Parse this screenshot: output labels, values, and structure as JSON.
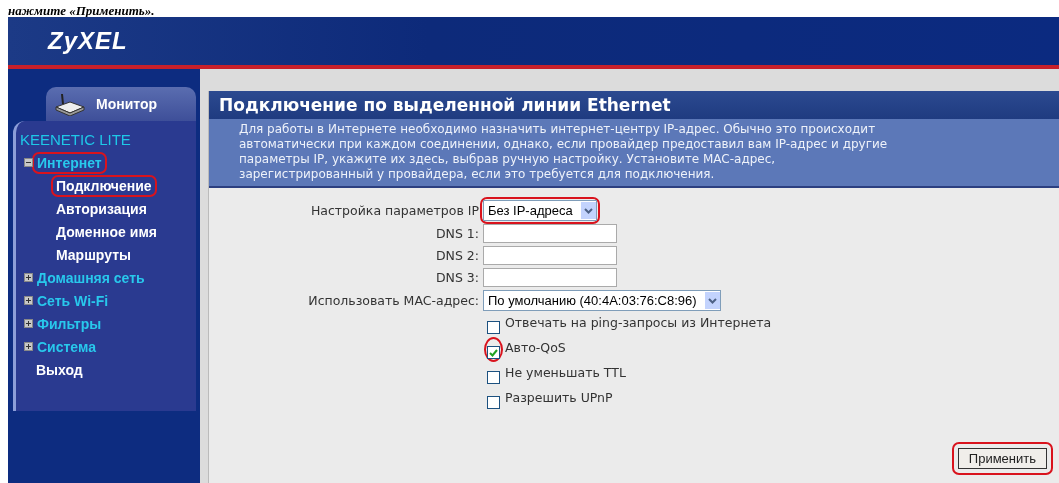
{
  "caption": "нажмите «Применить».",
  "brand": "ZyXEL",
  "sidebar": {
    "monitor_tab": "Монитор",
    "device": "KEENETIC LITE",
    "items": [
      {
        "kind": "group",
        "label": "Интернет",
        "expanded": true,
        "highlighted": true,
        "children": [
          {
            "label": "Подключение",
            "highlighted": true
          },
          {
            "label": "Авторизация",
            "highlighted": false
          },
          {
            "label": "Доменное имя",
            "highlighted": false
          },
          {
            "label": "Маршруты",
            "highlighted": false
          }
        ]
      },
      {
        "kind": "group",
        "label": "Домашняя сеть",
        "expanded": false,
        "highlighted": false
      },
      {
        "kind": "group",
        "label": "Сеть Wi-Fi",
        "expanded": false,
        "highlighted": false
      },
      {
        "kind": "group",
        "label": "Фильтры",
        "expanded": false,
        "highlighted": false
      },
      {
        "kind": "group",
        "label": "Система",
        "expanded": false,
        "highlighted": false
      },
      {
        "kind": "link",
        "label": "Выход",
        "highlighted": false
      }
    ]
  },
  "page": {
    "title": "Подключение по выделенной линии Ethernet",
    "description": "Для работы в Интернете необходимо назначить интернет-центру IP-адрес. Обычно это происходит автоматически при каждом соединении, однако, если провайдер предоставил вам IP-адрес и другие параметры IP, укажите их здесь, выбрав ручную настройку. Установите MAC-адрес, зарегистрированный у провайдера, если это требуется для подключения.",
    "fields": [
      {
        "kind": "select",
        "label": "Настройка параметров IP",
        "value": "Без IP-адреса",
        "highlighted": true
      },
      {
        "kind": "text",
        "label": "DNS 1:",
        "highlighted": false
      },
      {
        "kind": "text",
        "label": "DNS 2:",
        "highlighted": false
      },
      {
        "kind": "text",
        "label": "DNS 3:",
        "highlighted": false
      },
      {
        "kind": "select",
        "label": "Использовать MAC-адрес:",
        "value": "По умолчанию (40:4A:03:76:C8:96)",
        "highlighted": false
      }
    ],
    "checkboxes": [
      {
        "label": "Отвечать на ping-запросы из Интернета",
        "checked": false,
        "highlighted": false
      },
      {
        "label": "Авто-QoS",
        "checked": true,
        "highlighted": true
      },
      {
        "label": "Не уменьшать TTL",
        "checked": false,
        "highlighted": false
      },
      {
        "label": "Разрешить UPnP",
        "checked": false,
        "highlighted": false
      }
    ],
    "apply_button": {
      "label": "Применить",
      "highlighted": true
    }
  }
}
